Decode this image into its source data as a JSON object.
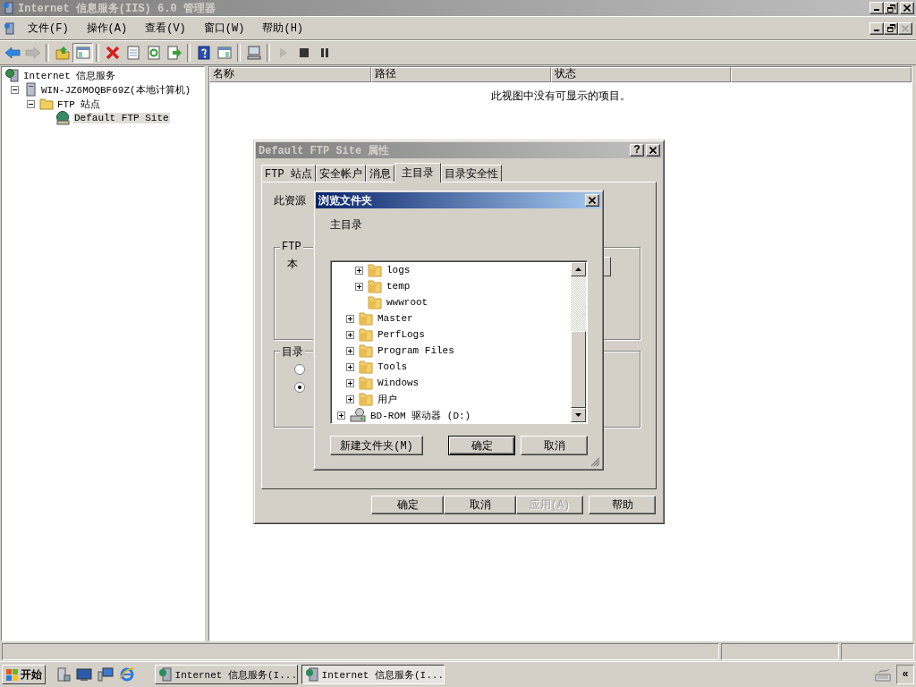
{
  "window": {
    "title": "Internet 信息服务(IIS) 6.0 管理器",
    "active": false
  },
  "menu": [
    "文件(F)",
    "操作(A)",
    "查看(V)",
    "窗口(W)",
    "帮助(H)"
  ],
  "mdi_controls": [
    {
      "kind": "minimize",
      "disabled": false
    },
    {
      "kind": "restore",
      "disabled": false
    },
    {
      "kind": "close",
      "disabled": true
    }
  ],
  "toolbar_groups": [
    {
      "buttons": [
        {
          "kind": "back",
          "disabled": false,
          "pressed": false
        },
        {
          "kind": "forward",
          "disabled": true,
          "pressed": false
        }
      ]
    },
    {
      "buttons": [
        {
          "kind": "up",
          "disabled": false,
          "pressed": false
        },
        {
          "kind": "tree-toggle",
          "disabled": false,
          "pressed": true
        }
      ]
    },
    {
      "buttons": [
        {
          "kind": "delete",
          "disabled": false,
          "pressed": false
        },
        {
          "kind": "properties",
          "disabled": false,
          "pressed": false
        },
        {
          "kind": "refresh",
          "disabled": false,
          "pressed": false
        },
        {
          "kind": "export",
          "disabled": false,
          "pressed": false
        }
      ]
    },
    {
      "buttons": [
        {
          "kind": "help",
          "disabled": false,
          "pressed": false
        },
        {
          "kind": "pane",
          "disabled": false,
          "pressed": false
        }
      ]
    },
    {
      "buttons": [
        {
          "kind": "computer",
          "disabled": false,
          "pressed": false
        }
      ]
    },
    {
      "buttons": [
        {
          "kind": "play",
          "disabled": true,
          "pressed": false
        },
        {
          "kind": "stop",
          "disabled": false,
          "pressed": false
        },
        {
          "kind": "pause",
          "disabled": false,
          "pressed": false
        }
      ]
    }
  ],
  "tree": [
    {
      "label": "Internet 信息服务",
      "kind": "iis",
      "expandable": false,
      "selected": false,
      "children": [
        {
          "label": "WIN-JZ6MOQBF69Z(本地计算机)",
          "kind": "server",
          "expandable": true,
          "expanded": true,
          "selected": false,
          "children": [
            {
              "label": "FTP 站点",
              "kind": "folder",
              "expandable": true,
              "expanded": true,
              "selected": false,
              "children": [
                {
                  "label": "Default FTP Site",
                  "kind": "ftp-site",
                  "expandable": false,
                  "selected": true
                }
              ]
            }
          ]
        }
      ]
    }
  ],
  "list": {
    "columns": [
      "名称",
      "路径",
      "状态"
    ],
    "empty_message": "此视图中没有可显示的项目。"
  },
  "properties_dialog": {
    "title": "Default FTP Site 属性",
    "active": false,
    "help_button": "?",
    "tabs": [
      {
        "label": "FTP 站点",
        "selected": false
      },
      {
        "label": "安全帐户",
        "selected": false
      },
      {
        "label": "消息",
        "selected": false
      },
      {
        "label": "主目录",
        "selected": true
      },
      {
        "label": "目录安全性",
        "selected": false
      }
    ],
    "intro_text": "此资源",
    "group_1_label": "FTP",
    "group_1_text": "本",
    "group_2_label": "目录",
    "radios": [
      {
        "selected": false
      },
      {
        "selected": true
      }
    ],
    "buttons": [
      {
        "label": "确定",
        "disabled": false
      },
      {
        "label": "取消",
        "disabled": false
      },
      {
        "label": "应用(A)",
        "disabled": true
      },
      {
        "label": "帮助",
        "disabled": false
      }
    ]
  },
  "browse_dialog": {
    "title": "浏览文件夹",
    "active": true,
    "prompt": "主目录",
    "tree": [
      {
        "children": [
          {
            "children": [
              {
                "label": "logs",
                "kind": "folder",
                "expandable": true,
                "expanded": false
              },
              {
                "label": "temp",
                "kind": "folder",
                "expandable": true,
                "expanded": false
              },
              {
                "label": "wwwroot",
                "kind": "folder",
                "expandable": false
              }
            ]
          },
          {
            "label": "Master",
            "kind": "folder",
            "expandable": true,
            "expanded": false
          },
          {
            "label": "PerfLogs",
            "kind": "folder",
            "expandable": true,
            "expanded": false
          },
          {
            "label": "Program Files",
            "kind": "folder",
            "expandable": true,
            "expanded": false
          },
          {
            "label": "Tools",
            "kind": "folder",
            "expandable": true,
            "expanded": false
          },
          {
            "label": "Windows",
            "kind": "folder",
            "expandable": true,
            "expanded": false
          },
          {
            "label": "用户",
            "kind": "folder",
            "expandable": true,
            "expanded": false
          }
        ]
      },
      {
        "label": "BD-ROM 驱动器 (D:)",
        "kind": "drive",
        "expandable": true,
        "expanded": false
      }
    ],
    "buttons": [
      {
        "label": "新建文件夹(M)",
        "default": false
      },
      {
        "label": "确定",
        "default": true
      },
      {
        "label": "取消",
        "default": false
      }
    ]
  },
  "taskbar": {
    "start": "开始",
    "quick_launch": [
      {
        "kind": "server-manager"
      },
      {
        "kind": "desktop"
      },
      {
        "kind": "network"
      },
      {
        "kind": "browser"
      }
    ],
    "tasks": [
      {
        "label": "Internet 信息服务(I...",
        "selected": false
      },
      {
        "label": "Internet 信息服务(I...",
        "selected": true
      }
    ],
    "tray_toggle": "«"
  }
}
